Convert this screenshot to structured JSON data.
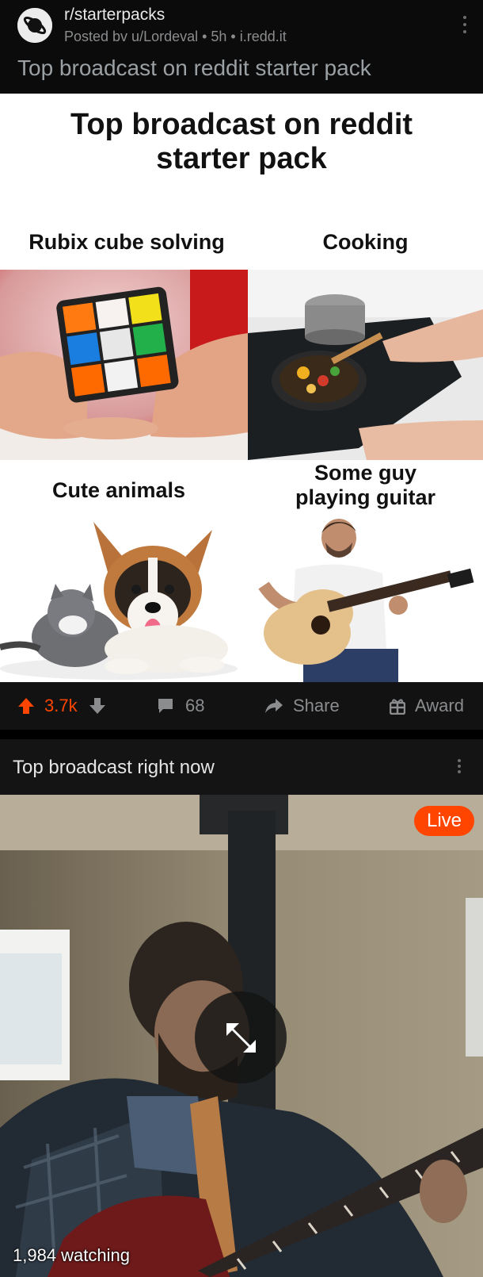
{
  "post": {
    "subreddit": "r/starterpacks",
    "meta": "Posted bv u/Lordeval • 5h • i.redd.it",
    "title": "Top broadcast on reddit starter pack"
  },
  "meme": {
    "title_line1": "Top broadcast on reddit",
    "title_line2": "starter pack",
    "captions": {
      "rubix": "Rubix cube solving",
      "cooking": "Cooking",
      "animals": "Cute animals",
      "guitar_line1": "Some guy",
      "guitar_line2": "playing guitar"
    }
  },
  "actions": {
    "upvotes": "3.7k",
    "comments": "68",
    "share": "Share",
    "award": "Award"
  },
  "broadcast": {
    "title": "Top broadcast right now",
    "live_label": "Live",
    "watching": "1,984 watching"
  },
  "colors": {
    "accent": "#ff4500",
    "background": "#000000",
    "muted_text": "#8a8c8e"
  },
  "icons": [
    "planet-icon",
    "kebab-icon",
    "upvote-arrow-icon",
    "downvote-arrow-icon",
    "comment-bubble-icon",
    "share-arrow-icon",
    "gift-icon",
    "expand-icon"
  ]
}
